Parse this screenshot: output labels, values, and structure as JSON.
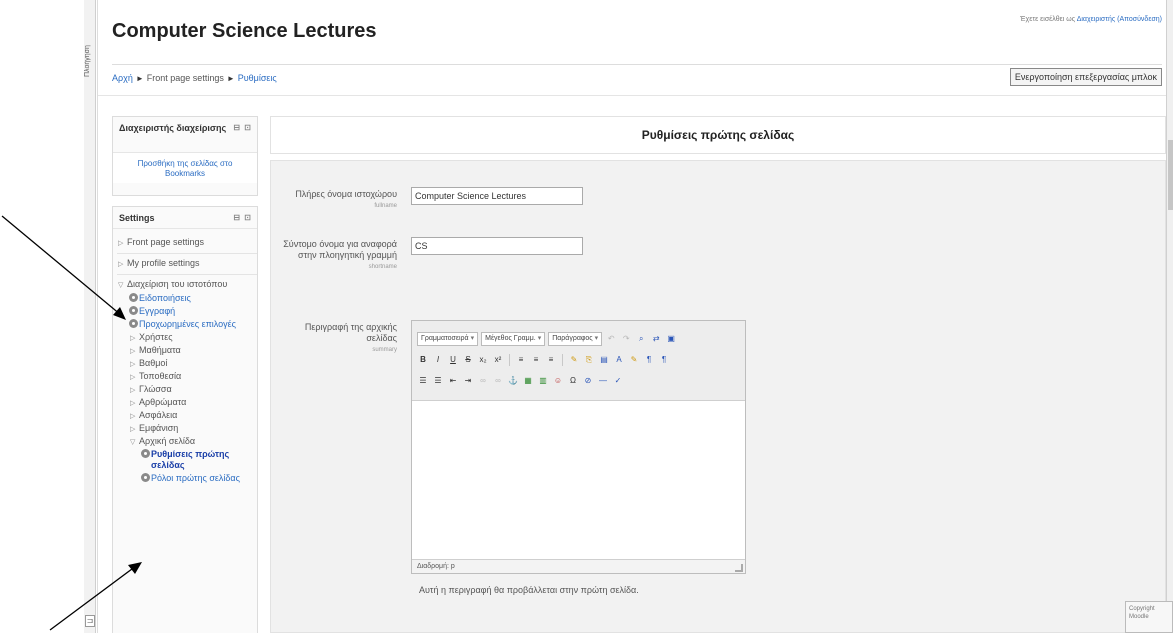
{
  "side_strip": {
    "label": "Πλοήγηση"
  },
  "header": {
    "site_title": "Computer Science Lectures",
    "login_prefix": "Έχετε εισέλθει ως",
    "login_user": "Διαχειριστής (Αποσύνδεση)",
    "edit_button": "Ενεργοποίηση επεξεργασίας μπλοκ"
  },
  "breadcrumb": {
    "home": "Αρχή",
    "front_page_settings": "Front page settings",
    "current": "Ρυθμίσεις",
    "separator": "►"
  },
  "admin_block": {
    "title": "Διαχειριστής διαχείρισης",
    "controls": "⊟ ⊡",
    "link": "Προσθήκη της σελίδας στο Bookmarks"
  },
  "settings_block": {
    "title": "Settings",
    "controls": "⊟ ⊡",
    "items": {
      "front_page_settings": "Front page settings",
      "my_profile_settings": "My profile settings",
      "site_admin": "Διαχείριση του ιστοτόπου",
      "notifications": "Ειδοποιήσεις",
      "registration": "Εγγραφή",
      "advanced_features": "Προχωρημένες επιλογές",
      "users": "Χρήστες",
      "courses": "Μαθήματα",
      "grades": "Βαθμοί",
      "location": "Τοποθεσία",
      "language": "Γλώσσα",
      "plugins": "Αρθρώματα",
      "security": "Ασφάλεια",
      "appearance": "Εμφάνιση",
      "front_page": "Αρχική σελίδα",
      "front_page_settings_gr": "Ρυθμίσεις πρώτης σελίδας",
      "front_page_roles": "Ρόλοι πρώτης σελίδας"
    }
  },
  "main": {
    "heading": "Ρυθμίσεις πρώτης σελίδας",
    "fields": {
      "fullname": {
        "label": "Πλήρες όνομα ιστοχώρου",
        "sub": "fullname",
        "value": "Computer Science Lectures"
      },
      "shortname": {
        "label": "Σύντομο όνομα για αναφορά στην πλοηγητική γραμμή",
        "sub": "shortname",
        "value": "CS"
      },
      "summary": {
        "label": "Περιγραφή της αρχικής σελίδας",
        "sub": "summary"
      }
    },
    "editor": {
      "font_family": "Γραμματοσειρά",
      "font_size": "Μέγεθος Γραμμ.",
      "format": "Παράγραφος",
      "path": "Διαδρομή: p"
    },
    "help_text": "Αυτή η περιγραφή θα προβάλλεται στην πρώτη σελίδα."
  },
  "corner_box": {
    "line1": "Copyright",
    "line2": "Moodle"
  },
  "colors": {
    "link": "#2a6cc2",
    "form_bg": "#f2f2f2",
    "current": "#1a3fa8"
  }
}
